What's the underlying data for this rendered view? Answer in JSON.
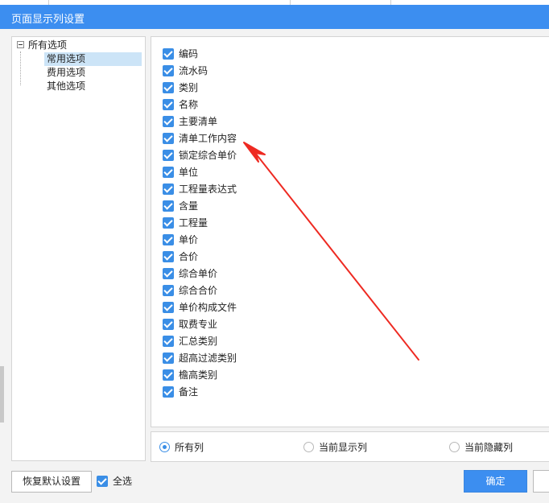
{
  "dialog": {
    "title": "页面显示列设置"
  },
  "tree": {
    "root": "所有选项",
    "children": [
      {
        "label": "常用选项",
        "selected": true
      },
      {
        "label": "费用选项",
        "selected": false
      },
      {
        "label": "其他选项",
        "selected": false
      }
    ]
  },
  "columns": [
    {
      "label": "编码",
      "checked": true
    },
    {
      "label": "流水码",
      "checked": true
    },
    {
      "label": "类别",
      "checked": true
    },
    {
      "label": "名称",
      "checked": true
    },
    {
      "label": "主要清单",
      "checked": true
    },
    {
      "label": "清单工作内容",
      "checked": true
    },
    {
      "label": "锁定综合单价",
      "checked": true
    },
    {
      "label": "单位",
      "checked": true
    },
    {
      "label": "工程量表达式",
      "checked": true
    },
    {
      "label": "含量",
      "checked": true
    },
    {
      "label": "工程量",
      "checked": true
    },
    {
      "label": "单价",
      "checked": true
    },
    {
      "label": "合价",
      "checked": true
    },
    {
      "label": "综合单价",
      "checked": true
    },
    {
      "label": "综合合价",
      "checked": true
    },
    {
      "label": "单价构成文件",
      "checked": true
    },
    {
      "label": "取费专业",
      "checked": true
    },
    {
      "label": "汇总类别",
      "checked": true
    },
    {
      "label": "超高过滤类别",
      "checked": true
    },
    {
      "label": "檐高类别",
      "checked": true
    },
    {
      "label": "备注",
      "checked": true
    }
  ],
  "filter": {
    "options": [
      {
        "label": "所有列",
        "selected": true
      },
      {
        "label": "当前显示列",
        "selected": false
      },
      {
        "label": "当前隐藏列",
        "selected": false
      }
    ]
  },
  "footer": {
    "restore_label": "恢复默认设置",
    "select_all_label": "全选",
    "select_all_checked": true,
    "ok_label": "确定"
  },
  "colors": {
    "accent": "#3c8ef0",
    "annotation_arrow": "#ee2a22",
    "tree_selection": "#cce4f7"
  }
}
